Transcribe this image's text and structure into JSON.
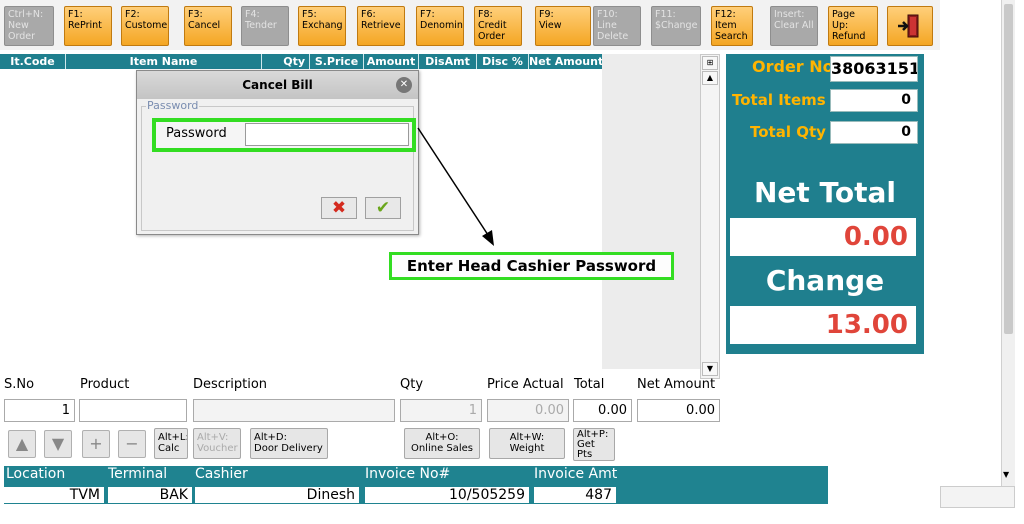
{
  "toolbar": {
    "keys": [
      {
        "label": "Ctrl+N:\nNew\nOrder",
        "enabled": false
      },
      {
        "label": "F1:\nRePrint",
        "enabled": true
      },
      {
        "label": "F2:\nCustome",
        "enabled": true
      },
      {
        "label": "F3:\nCancel",
        "enabled": true
      },
      {
        "label": "F4:\nTender",
        "enabled": false
      },
      {
        "label": "F5:\nExchang",
        "enabled": true
      },
      {
        "label": "F6:\nRetrieve",
        "enabled": true
      },
      {
        "label": "F7:\nDenomin",
        "enabled": true
      },
      {
        "label": "F8:\nCredit\nOrder",
        "enabled": true
      },
      {
        "label": "F9:\nView",
        "enabled": true
      },
      {
        "label": "F10:\nLine\nDelete",
        "enabled": false
      },
      {
        "label": "F11:\n$Change",
        "enabled": false
      },
      {
        "label": "F12:\nItem\nSearch",
        "enabled": true
      },
      {
        "label": "Insert:\nClear All",
        "enabled": false
      },
      {
        "label": "Page\nUp:\nRefund",
        "enabled": true
      }
    ],
    "exit_icon": "exit-door-icon"
  },
  "grid": {
    "columns": [
      "It.Code",
      "Item Name",
      "Qty",
      "S.Price",
      "Amount",
      "DisAmt",
      "Disc %",
      "Net Amount"
    ]
  },
  "summary": {
    "order_no_label": "Order No",
    "order_no": "38063151",
    "total_items_label": "Total Items",
    "total_items": "0",
    "total_qty_label": "Total Qty",
    "total_qty": "0",
    "net_total_label": "Net Total",
    "net_total": "0.00",
    "change_label": "Change",
    "change": "13.00"
  },
  "entry": {
    "sno_label": "S.No",
    "sno": "1",
    "product_label": "Product",
    "product": "",
    "description_label": "Description",
    "description": "",
    "qty_label": "Qty",
    "qty": "1",
    "price_actual_label": "Price Actual",
    "price_actual": "0.00",
    "total_label": "Total",
    "total": "0.00",
    "net_amount_label": "Net Amount",
    "net_amount": "0.00"
  },
  "shortcuts": {
    "calc": "Alt+L:\nCalc",
    "voucher": "Alt+V:\nVoucher",
    "door_delivery": "Alt+D:\nDoor Delivery",
    "online_sales": "Alt+O:\nOnline Sales",
    "weight": "Alt+W:\nWeight",
    "get_pts": "Alt+P:\nGet\nPts"
  },
  "footer": {
    "location_label": "Location",
    "location": "TVM",
    "terminal_label": "Terminal",
    "terminal": "BAK",
    "cashier_label": "Cashier",
    "cashier": "Dinesh",
    "invoice_no_label": "Invoice No#",
    "invoice_no": "10/505259",
    "invoice_amt_label": "Invoice Amt",
    "invoice_amt": "487"
  },
  "dialog": {
    "title": "Cancel Bill",
    "group_label": "Password",
    "field_label": "Password",
    "field_value": ""
  },
  "callout": {
    "text": "Enter Head Cashier Password"
  },
  "colors": {
    "accent_teal": "#1f7f8e",
    "fkey_orange": "#f4a623",
    "highlight_green": "#33dd22",
    "amount_red": "#e0453a",
    "label_gold": "#ffb400"
  }
}
